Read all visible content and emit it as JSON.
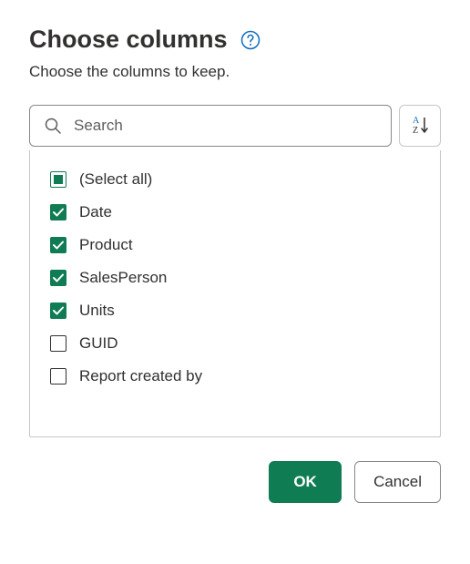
{
  "title": "Choose columns",
  "subtitle": "Choose the columns to keep.",
  "search": {
    "placeholder": "Search"
  },
  "columns": {
    "selectAll": {
      "label": "(Select all)",
      "state": "indeterminate"
    },
    "items": [
      {
        "label": "Date",
        "checked": true
      },
      {
        "label": "Product",
        "checked": true
      },
      {
        "label": "SalesPerson",
        "checked": true
      },
      {
        "label": "Units",
        "checked": true
      },
      {
        "label": "GUID",
        "checked": false
      },
      {
        "label": "Report created by",
        "checked": false
      }
    ]
  },
  "buttons": {
    "ok": "OK",
    "cancel": "Cancel"
  },
  "colors": {
    "accent": "#107c54",
    "helpIcon": "#0f6cbd"
  }
}
